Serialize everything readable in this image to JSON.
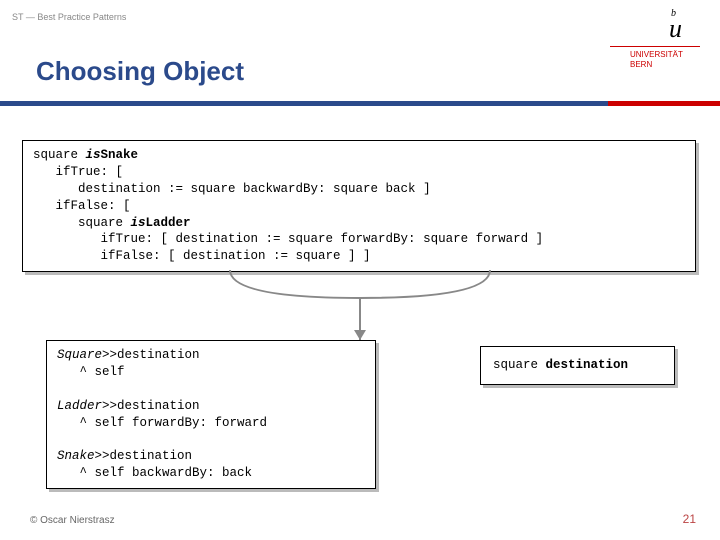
{
  "header": {
    "breadcrumb": "ST — Best Practice Patterns",
    "title": "Choosing Object"
  },
  "logo": {
    "exp": "b",
    "letter": "u",
    "uni_line1": "UNIVERSITÄT",
    "uni_line2": "BERN"
  },
  "code": {
    "box1_l1a": "square ",
    "box1_l1b": "is",
    "box1_l1c": "Snake",
    "box1_l2": "   ifTrue: [",
    "box1_l3": "      destination := square backwardBy: square back ]",
    "box1_l4": "   ifFalse: [",
    "box1_l5a": "      square ",
    "box1_l5b": "is",
    "box1_l5c": "Ladder",
    "box1_l6": "         ifTrue: [ destination := square forwardBy: square forward ]",
    "box1_l7": "         ifFalse: [ destination := square ] ]",
    "box2_l1a": "Square",
    "box2_l1b": ">>destination",
    "box2_l2": "   ^ self",
    "box2_blank": " ",
    "box2_l3a": "Ladder",
    "box2_l3b": ">>destination",
    "box2_l4": "   ^ self forwardBy: forward",
    "box2_l5a": "Snake",
    "box2_l5b": ">>destination",
    "box2_l6": "   ^ self backwardBy: back",
    "box3a": "square ",
    "box3b": "destination"
  },
  "footer": {
    "copyright": "© Oscar Nierstrasz",
    "page": "21"
  }
}
